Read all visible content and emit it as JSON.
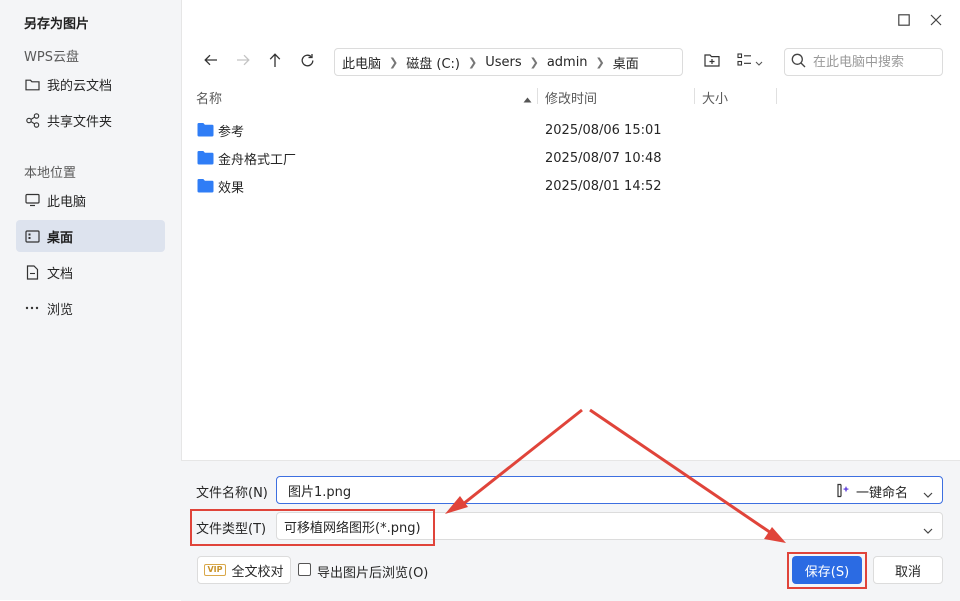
{
  "dialog": {
    "title": "另存为图片"
  },
  "sidebar": {
    "cloud_section": "WPS云盘",
    "cloud_items": [
      {
        "label": "我的云文档",
        "icon": "folder-outline-icon"
      },
      {
        "label": "共享文件夹",
        "icon": "share-icon"
      }
    ],
    "local_section": "本地位置",
    "local_items": [
      {
        "label": "此电脑",
        "icon": "monitor-icon",
        "active": false
      },
      {
        "label": "桌面",
        "icon": "desktop-icon",
        "active": true
      },
      {
        "label": "文档",
        "icon": "document-icon",
        "active": false
      },
      {
        "label": "浏览",
        "icon": "more-dots-icon",
        "active": false
      }
    ]
  },
  "window_controls": {
    "maximize_icon": "maximize-icon",
    "close_icon": "close-icon"
  },
  "nav": {
    "back_icon": "arrow-left-icon",
    "forward_icon": "arrow-right-icon",
    "up_icon": "arrow-up-icon",
    "refresh_icon": "refresh-icon"
  },
  "breadcrumb": [
    "此电脑",
    "磁盘 (C:)",
    "Users",
    "admin",
    "桌面"
  ],
  "toolbar": {
    "new_folder_icon": "new-folder-icon",
    "view_icon": "view-list-icon"
  },
  "search": {
    "placeholder": "在此电脑中搜索"
  },
  "columns": {
    "name": "名称",
    "modified": "修改时间",
    "size": "大小"
  },
  "files": [
    {
      "name": "参考",
      "modified": "2025/08/06 15:01",
      "type": "folder"
    },
    {
      "name": "金舟格式工厂",
      "modified": "2025/08/07 10:48",
      "type": "folder"
    },
    {
      "name": "效果",
      "modified": "2025/08/01 14:52",
      "type": "folder"
    }
  ],
  "form": {
    "filename_label": "文件名称(N)",
    "filename_value": "图片1.png",
    "one_click_name": "一键命名",
    "filetype_label": "文件类型(T)",
    "filetype_value": "可移植网络图形(*.png)"
  },
  "footer": {
    "vip_badge": "VIP",
    "proofread_label": "全文校对",
    "browse_after_export_label": "导出图片后浏览(O)",
    "browse_after_export_checked": false,
    "save_label": "保存(S)",
    "cancel_label": "取消"
  },
  "colors": {
    "accent": "#2b6be3",
    "folder": "#2f7df6",
    "annotation": "#e0443a"
  }
}
